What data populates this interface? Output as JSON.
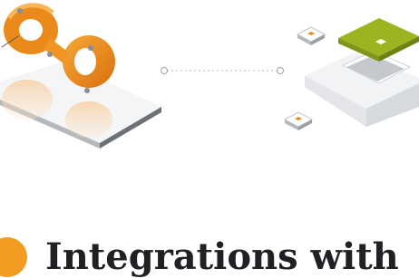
{
  "colors": {
    "accent": "#f39c21",
    "text": "#202124",
    "chip_green": "#9ab51f",
    "connector": "#b8bcc2"
  },
  "illustration": {
    "left_object_icon": "infinity-ring-on-tablet-icon",
    "right_object_icon": "processor-chip-board-icon",
    "connector_icon": "dotted-connector-icon"
  },
  "heading": {
    "icon": "orange-circle-icon",
    "title": "Integrations with"
  }
}
